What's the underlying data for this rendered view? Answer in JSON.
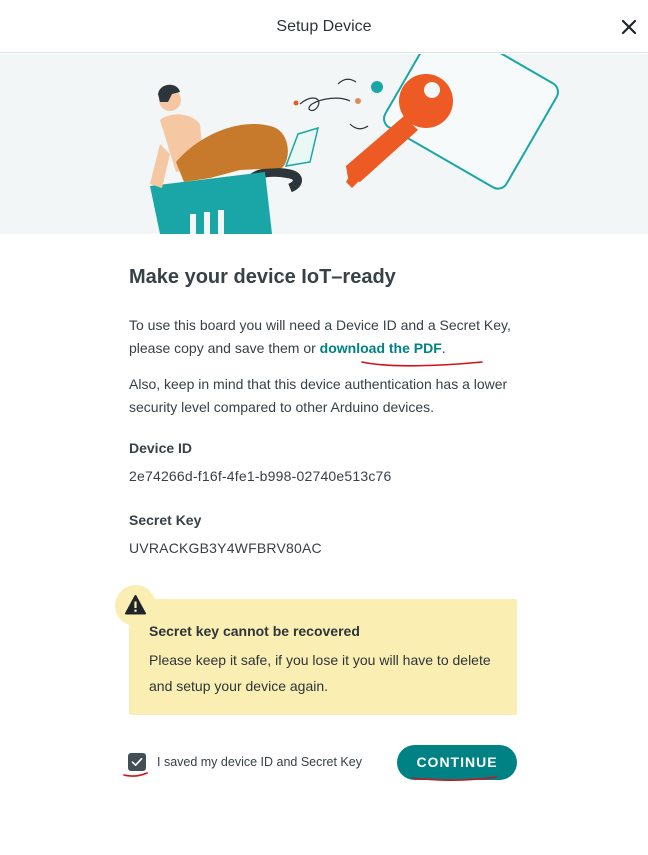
{
  "header": {
    "title": "Setup Device"
  },
  "content": {
    "heading": "Make your device IoT–ready",
    "p1_text": "To use this board you will need a Device ID and a Secret Key, please copy and save them or ",
    "p1_link": "download the PDF",
    "p1_end": ".",
    "p2": "Also, keep in mind that this device authentication has a lower security level compared to other Arduino devices.",
    "device_id_label": "Device ID",
    "device_id_value": "2e74266d-f16f-4fe1-b998-02740e513c76",
    "secret_key_label": "Secret Key",
    "secret_key_value": "UVRACKGB3Y4WFBRV80AC"
  },
  "warning": {
    "title": "Secret key cannot be recovered",
    "text": "Please keep it safe, if you lose it you will have to delete and setup your device again."
  },
  "footer": {
    "checkbox_label": "I saved my device ID and Secret Key",
    "checkbox_checked": true,
    "continue_label": "CONTINUE"
  },
  "colors": {
    "accent": "#008184",
    "warning_bg": "#fbeeb2",
    "annotation": "#d0121b"
  },
  "icons": {
    "close": "close-icon",
    "warning": "warning-icon",
    "check": "check-icon"
  }
}
